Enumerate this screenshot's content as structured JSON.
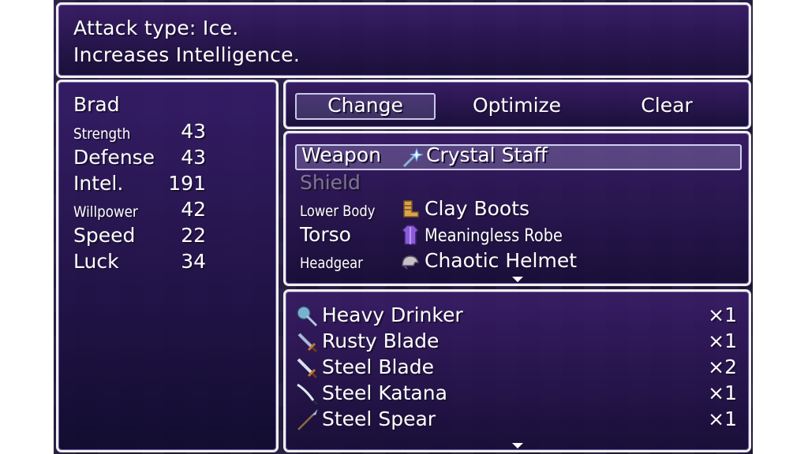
{
  "help": {
    "line1": "Attack type: Ice.",
    "line2": "Increases Intelligence."
  },
  "actor": {
    "name": "Brad",
    "stats": [
      {
        "label": "Strength",
        "value": "43",
        "style": "small"
      },
      {
        "label": "Defense",
        "value": "43",
        "style": "big"
      },
      {
        "label": "Intel.",
        "value": "191",
        "style": "big"
      },
      {
        "label": "Willpower",
        "value": "42",
        "style": "small"
      },
      {
        "label": "Speed",
        "value": "22",
        "style": "big"
      },
      {
        "label": "Luck",
        "value": "34",
        "style": "big"
      }
    ]
  },
  "commands": [
    {
      "label": "Change",
      "selected": true
    },
    {
      "label": "Optimize",
      "selected": false
    },
    {
      "label": "Clear",
      "selected": false
    }
  ],
  "slots": [
    {
      "type": "Weapon",
      "item": "Crystal Staff",
      "icon": "staff-icon",
      "selected": true
    },
    {
      "type": "Shield",
      "item": "",
      "icon": "",
      "disabled": true
    },
    {
      "type": "Lower Body",
      "item": "Clay Boots",
      "icon": "boots-icon"
    },
    {
      "type": "Torso",
      "item": "Meaningless Robe",
      "icon": "robe-icon"
    },
    {
      "type": "Headgear",
      "item": "Chaotic Helmet",
      "icon": "helmet-icon"
    }
  ],
  "items": [
    {
      "name": "Heavy Drinker",
      "count": "×1",
      "icon": "mace-icon"
    },
    {
      "name": "Rusty Blade",
      "count": "×1",
      "icon": "sword-icon"
    },
    {
      "name": "Steel Blade",
      "count": "×2",
      "icon": "sword-icon"
    },
    {
      "name": "Steel Katana",
      "count": "×1",
      "icon": "katana-icon"
    },
    {
      "name": "Steel Spear",
      "count": "×1",
      "icon": "spear-icon"
    }
  ],
  "colors": {
    "window_top": "#3a1c68",
    "window_bottom": "#180e38",
    "border": "#f0f0f0",
    "disabled_text": "#7e7590"
  }
}
